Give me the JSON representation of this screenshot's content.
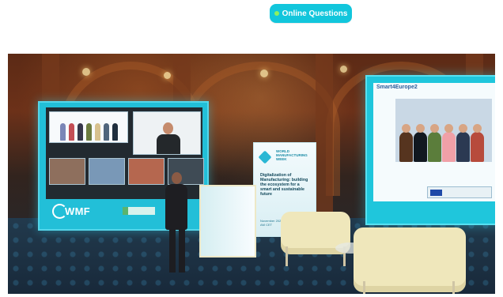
{
  "header": {
    "button_label": "Online Questions",
    "button_color": "#12c6dc",
    "button_dot_color": "#8df060"
  },
  "photo": {
    "left_screen_logo": "WMF",
    "poster": {
      "brand": "WORLD MANUFACTURING WEEK",
      "title": "Digitalization of Manufacturing: building the ecosystem for a smart and sustainable future",
      "date": "November 2021 | 10:00 AM - 11:30 AM CET"
    },
    "right_screen_title": "Smart4Europe2"
  }
}
